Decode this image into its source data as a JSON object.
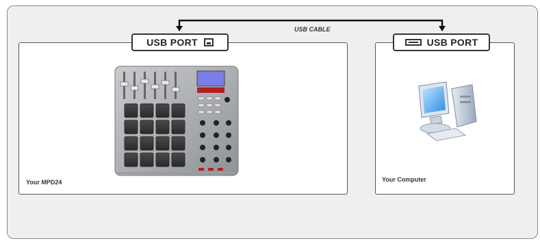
{
  "diagram": {
    "cable_label": "USB CABLE",
    "left_port_label": "USB PORT",
    "right_port_label": "USB PORT",
    "left_device_caption": "Your MPD24",
    "right_device_caption": "Your Computer"
  },
  "icons": {
    "left_port_icon": "usb-b-port-icon",
    "right_port_icon": "usb-a-port-icon",
    "left_device_image": "mpd24-controller",
    "right_device_image": "desktop-computer"
  }
}
